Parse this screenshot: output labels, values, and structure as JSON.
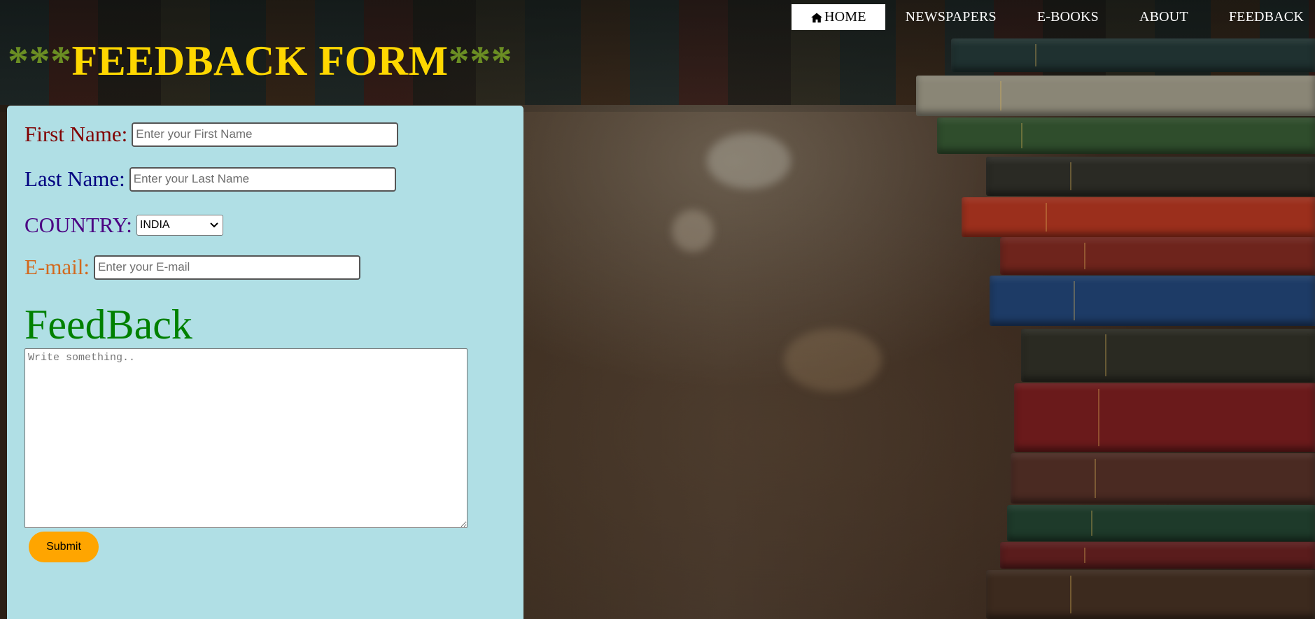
{
  "nav": {
    "items": [
      {
        "label": "HOME",
        "active": true
      },
      {
        "label": "NEWSPAPERS",
        "active": false
      },
      {
        "label": "E-BOOKS",
        "active": false
      },
      {
        "label": "ABOUT",
        "active": false
      },
      {
        "label": "FEEDBACK",
        "active": false
      }
    ]
  },
  "header": {
    "stars_left": "***",
    "title": "FEEDBACK FORM",
    "stars_right": "***"
  },
  "form": {
    "first_name": {
      "label": "First Name:",
      "value": "",
      "placeholder": "Enter your First Name"
    },
    "last_name": {
      "label": "Last Name:",
      "value": "",
      "placeholder": "Enter your Last Name"
    },
    "country": {
      "label": "COUNTRY:",
      "selected": "INDIA"
    },
    "email": {
      "label": "E-mail:",
      "value": "",
      "placeholder": "Enter your E-mail"
    },
    "feedback": {
      "heading": "FeedBack",
      "value": "",
      "placeholder": "Write something.."
    },
    "submit_label": "Submit"
  },
  "colors": {
    "title": "#ffd700",
    "stars": "#6b8e23",
    "panel_bg": "#b0dfe5",
    "first_label": "#800000",
    "last_label": "#000080",
    "country_label": "#4b0082",
    "email_label": "#d2691e",
    "feedback_heading": "#008000",
    "submit_bg": "#ffa500"
  },
  "icons": {
    "home": "home-icon",
    "select_arrow": "chevron-down-icon"
  }
}
